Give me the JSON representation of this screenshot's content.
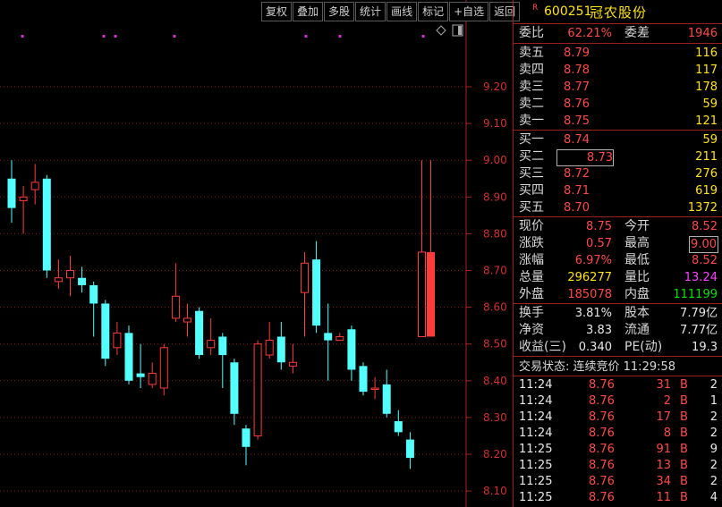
{
  "toolbar": [
    "复权",
    "叠加",
    "多股",
    "统计",
    "画线",
    "标记",
    "+自选",
    "返回"
  ],
  "chart_data": {
    "type": "candlestick",
    "y_ticks": [
      "9.20",
      "9.10",
      "9.00",
      "8.90",
      "8.80",
      "8.70",
      "8.60",
      "8.50",
      "8.40",
      "8.30",
      "8.20",
      "8.10"
    ],
    "ylim": [
      8.08,
      9.28
    ],
    "candles": [
      {
        "o": 8.95,
        "c": 8.87,
        "h": 9.0,
        "l": 8.83
      },
      {
        "o": 8.89,
        "c": 8.9,
        "h": 8.93,
        "l": 8.8
      },
      {
        "o": 8.92,
        "c": 8.94,
        "h": 8.99,
        "l": 8.88
      },
      {
        "o": 8.95,
        "c": 8.7,
        "h": 8.96,
        "l": 8.68
      },
      {
        "o": 8.67,
        "c": 8.68,
        "h": 8.73,
        "l": 8.65
      },
      {
        "o": 8.68,
        "c": 8.7,
        "h": 8.74,
        "l": 8.63
      },
      {
        "o": 8.68,
        "c": 8.66,
        "h": 8.71,
        "l": 8.64
      },
      {
        "o": 8.66,
        "c": 8.61,
        "h": 8.67,
        "l": 8.52
      },
      {
        "o": 8.61,
        "c": 8.46,
        "h": 8.62,
        "l": 8.44
      },
      {
        "o": 8.49,
        "c": 8.53,
        "h": 8.56,
        "l": 8.47
      },
      {
        "o": 8.53,
        "c": 8.4,
        "h": 8.55,
        "l": 8.39
      },
      {
        "o": 8.42,
        "c": 8.41,
        "h": 8.5,
        "l": 8.38
      },
      {
        "o": 8.39,
        "c": 8.42,
        "h": 8.45,
        "l": 8.38
      },
      {
        "o": 8.38,
        "c": 8.49,
        "h": 8.5,
        "l": 8.36
      },
      {
        "o": 8.57,
        "c": 8.63,
        "h": 8.72,
        "l": 8.56
      },
      {
        "o": 8.56,
        "c": 8.57,
        "h": 8.61,
        "l": 8.52
      },
      {
        "o": 8.59,
        "c": 8.47,
        "h": 8.6,
        "l": 8.46
      },
      {
        "o": 8.49,
        "c": 8.51,
        "h": 8.57,
        "l": 8.47
      },
      {
        "o": 8.52,
        "c": 8.47,
        "h": 8.53,
        "l": 8.38
      },
      {
        "o": 8.45,
        "c": 8.31,
        "h": 8.46,
        "l": 8.28
      },
      {
        "o": 8.27,
        "c": 8.22,
        "h": 8.28,
        "l": 8.17
      },
      {
        "o": 8.25,
        "c": 8.5,
        "h": 8.51,
        "l": 8.24
      },
      {
        "o": 8.47,
        "c": 8.51,
        "h": 8.56,
        "l": 8.46
      },
      {
        "o": 8.52,
        "c": 8.45,
        "h": 8.56,
        "l": 8.43
      },
      {
        "o": 8.44,
        "c": 8.45,
        "h": 8.5,
        "l": 8.42
      },
      {
        "o": 8.64,
        "c": 8.72,
        "h": 8.75,
        "l": 8.52
      },
      {
        "o": 8.73,
        "c": 8.55,
        "h": 8.78,
        "l": 8.53
      },
      {
        "o": 8.53,
        "c": 8.51,
        "h": 8.61,
        "l": 8.4
      },
      {
        "o": 8.51,
        "c": 8.52,
        "h": 8.53,
        "l": 8.51
      },
      {
        "o": 8.54,
        "c": 8.43,
        "h": 8.55,
        "l": 8.4
      },
      {
        "o": 8.44,
        "c": 8.37,
        "h": 8.45,
        "l": 8.36
      },
      {
        "o": 8.38,
        "c": 8.38,
        "h": 8.41,
        "l": 8.35
      },
      {
        "o": 8.39,
        "c": 8.31,
        "h": 8.43,
        "l": 8.3
      },
      {
        "o": 8.29,
        "c": 8.26,
        "h": 8.32,
        "l": 8.25
      },
      {
        "o": 8.24,
        "c": 8.19,
        "h": 8.26,
        "l": 8.16
      },
      {
        "o": 8.52,
        "c": 8.75,
        "h": 9.0,
        "l": 8.52
      }
    ],
    "markers_x": [
      25,
      116,
      129,
      195,
      342,
      380,
      473
    ]
  },
  "quote": {
    "code": "600251",
    "name": "冠农股份",
    "r_tag": "R",
    "weibi_label": "委比",
    "weibi": "62.21%",
    "weicha_label": "委差",
    "weicha": "1946",
    "sells": [
      {
        "label": "卖五",
        "price": "8.79",
        "vol": "116"
      },
      {
        "label": "卖四",
        "price": "8.78",
        "vol": "117"
      },
      {
        "label": "卖三",
        "price": "8.77",
        "vol": "178"
      },
      {
        "label": "卖二",
        "price": "8.76",
        "vol": "59"
      },
      {
        "label": "卖一",
        "price": "8.75",
        "vol": "121"
      }
    ],
    "buys": [
      {
        "label": "买一",
        "price": "8.74",
        "vol": "59"
      },
      {
        "label": "买二",
        "price": "8.73",
        "vol": "211"
      },
      {
        "label": "买三",
        "price": "8.72",
        "vol": "276"
      },
      {
        "label": "买四",
        "price": "8.71",
        "vol": "619"
      },
      {
        "label": "买五",
        "price": "8.70",
        "vol": "1372"
      }
    ],
    "stats": [
      {
        "l1": "现价",
        "v1": "8.75",
        "c1": "red",
        "l2": "今开",
        "v2": "8.52",
        "c2": "red"
      },
      {
        "l1": "涨跌",
        "v1": "0.57",
        "c1": "red",
        "l2": "最高",
        "v2": "9.00",
        "c2": "red"
      },
      {
        "l1": "涨幅",
        "v1": "6.97%",
        "c1": "red",
        "l2": "最低",
        "v2": "8.52",
        "c2": "red"
      },
      {
        "l1": "总量",
        "v1": "296277",
        "c1": "yel",
        "l2": "量比",
        "v2": "13.24",
        "c2": "mag"
      },
      {
        "l1": "外盘",
        "v1": "185078",
        "c1": "red",
        "l2": "内盘",
        "v2": "111199",
        "c2": "grn"
      }
    ],
    "stats2": [
      {
        "l1": "换手",
        "v1": "3.81%",
        "l2": "股本",
        "v2": "7.79亿"
      },
      {
        "l1": "净资",
        "v1": "3.83",
        "l2": "流通",
        "v2": "7.77亿"
      },
      {
        "l1": "收益(三)",
        "v1": "0.340",
        "l2": "PE(动)",
        "v2": "19.3"
      }
    ],
    "trade_status": "交易状态: 连续竞价 11:29:58",
    "ticks": [
      {
        "t": "11:24",
        "p": "8.76",
        "v": "31",
        "s": "B",
        "n": "2"
      },
      {
        "t": "11:24",
        "p": "8.76",
        "v": "2",
        "s": "B",
        "n": "1"
      },
      {
        "t": "11:24",
        "p": "8.76",
        "v": "17",
        "s": "B",
        "n": "2"
      },
      {
        "t": "11:24",
        "p": "8.76",
        "v": "8",
        "s": "B",
        "n": "2"
      },
      {
        "t": "11:25",
        "p": "8.76",
        "v": "91",
        "s": "B",
        "n": "9"
      },
      {
        "t": "11:25",
        "p": "8.76",
        "v": "13",
        "s": "B",
        "n": "2"
      },
      {
        "t": "11:25",
        "p": "8.76",
        "v": "34",
        "s": "B",
        "n": "2"
      },
      {
        "t": "11:25",
        "p": "8.76",
        "v": "11",
        "s": "B",
        "n": "4"
      }
    ]
  }
}
